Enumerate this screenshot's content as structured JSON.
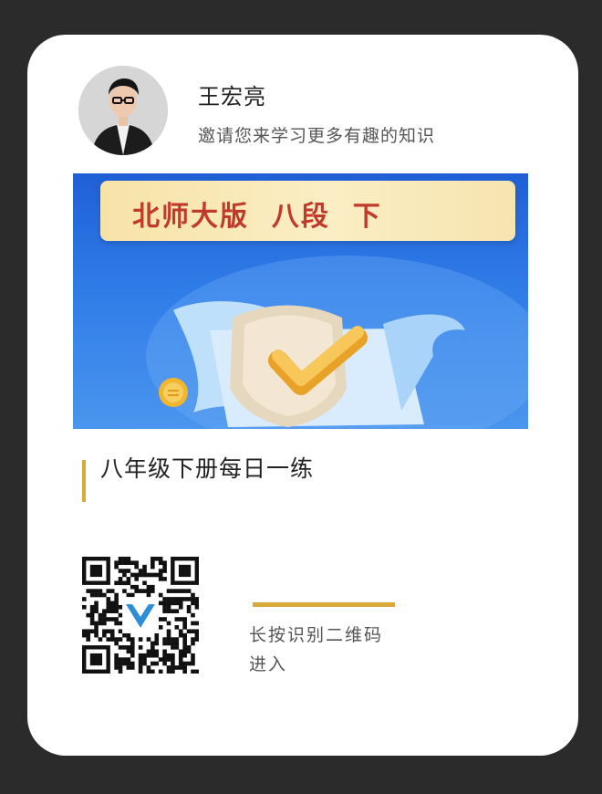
{
  "profile": {
    "name": "王宏亮",
    "invite": "邀请您来学习更多有趣的知识"
  },
  "banner": {
    "title": "北师大版  八段  下"
  },
  "course": {
    "title": "八年级下册每日一练"
  },
  "qr": {
    "hint_line1": "长按识别二维码",
    "hint_line2": "进入"
  },
  "colors": {
    "accent_gold": "#d9a83a",
    "banner_blue": "#2f7ce8",
    "banner_title_red": "#c0392b"
  }
}
